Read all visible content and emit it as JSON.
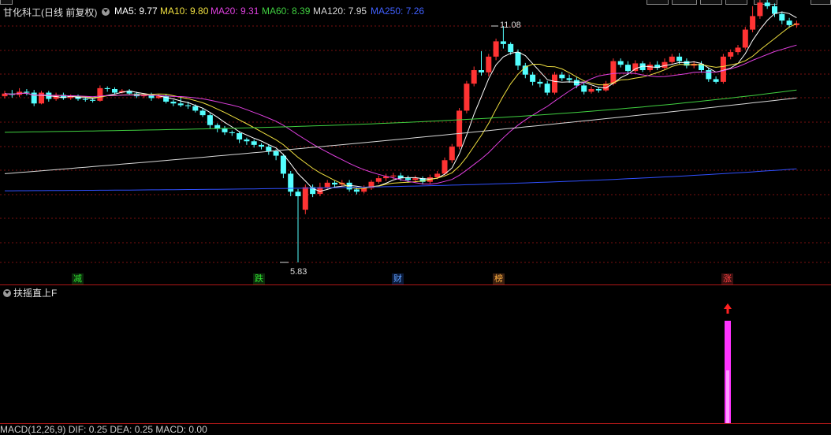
{
  "header": {
    "stock_name": "甘化科工",
    "period_label": "(日线 前复权)",
    "ma": [
      {
        "label": "MA5: 9.77",
        "color": "#ffffff"
      },
      {
        "label": "MA10: 9.80",
        "color": "#f0e040"
      },
      {
        "label": "MA20: 9.31",
        "color": "#e040e0"
      },
      {
        "label": "MA60: 8.39",
        "color": "#40d040"
      },
      {
        "label": "MA120: 7.95",
        "color": "#d8d8d8"
      },
      {
        "label": "MA250: 7.26",
        "color": "#4060ff"
      }
    ]
  },
  "annotations": {
    "high": "11.08",
    "low": "5.83"
  },
  "event_tags": [
    "减",
    "跌",
    "财",
    "榜",
    "涨"
  ],
  "indicator": {
    "title": "扶摇直上F"
  },
  "macd_line": "MACD(12,26,9) DIF: 0.25 DEA: 0.25 MACD: 0.00",
  "colors": {
    "up": "#ff3333",
    "down": "#54ffff",
    "grid": "#7a1010",
    "bar": "#ff33ff"
  }
}
